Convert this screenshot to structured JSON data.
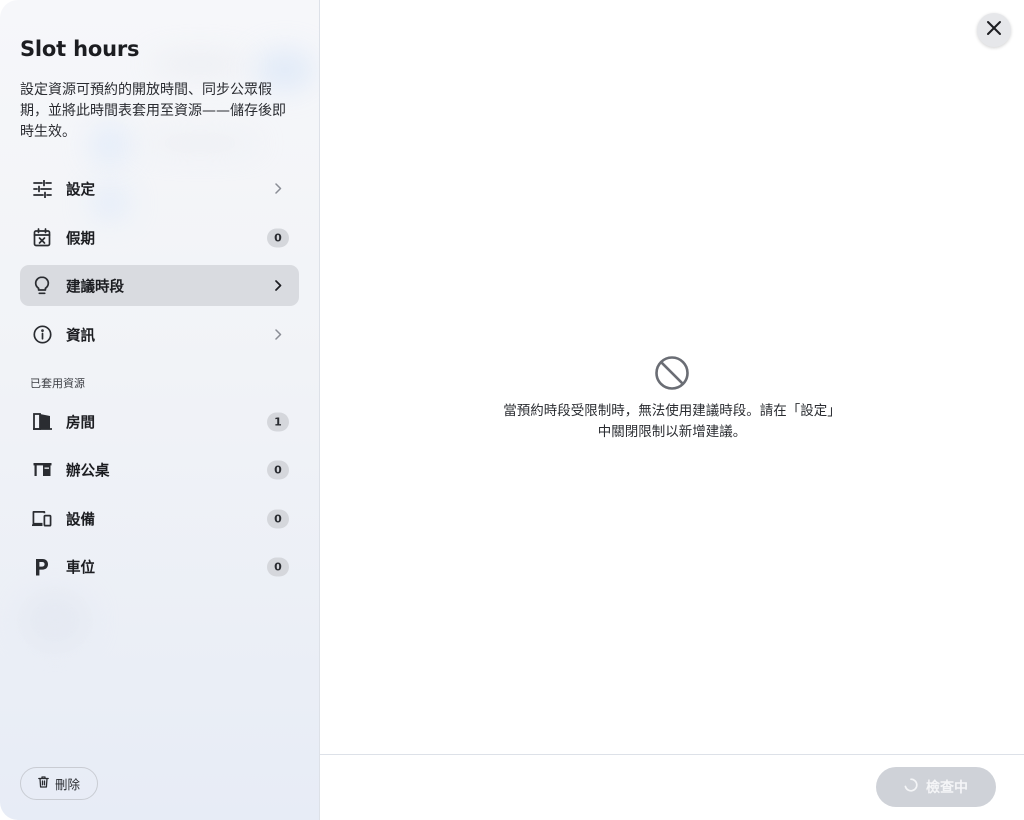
{
  "panel": {
    "title": "Slot hours",
    "description": "設定資源可預約的開放時間、同步公眾假期，並將此時間表套用至資源——儲存後即時生效。"
  },
  "nav": [
    {
      "id": "settings",
      "label": "設定",
      "icon": "sliders-icon",
      "has_chevron": true
    },
    {
      "id": "holidays",
      "label": "假期",
      "icon": "calendar-x-icon",
      "badge": "0"
    },
    {
      "id": "suggested",
      "label": "建議時段",
      "icon": "lightbulb-icon",
      "has_chevron": true,
      "active": true
    },
    {
      "id": "info",
      "label": "資訊",
      "icon": "info-icon",
      "has_chevron": true
    }
  ],
  "applied_resources": {
    "label": "已套用資源",
    "items": [
      {
        "id": "rooms",
        "label": "房間",
        "icon": "door-icon",
        "badge": "1"
      },
      {
        "id": "desks",
        "label": "辦公桌",
        "icon": "desk-icon",
        "badge": "0"
      },
      {
        "id": "equipment",
        "label": "設備",
        "icon": "devices-icon",
        "badge": "0"
      },
      {
        "id": "parking",
        "label": "車位",
        "icon": "parking-icon",
        "badge": "0"
      }
    ]
  },
  "actions": {
    "delete_label": "刪除",
    "checking_label": "檢查中"
  },
  "empty_state": {
    "icon": "block-icon",
    "line1": "當預約時段受限制時，無法使用建議時段。請在「設定」",
    "line2": "中關閉限制以新增建議。"
  },
  "colors": {
    "active_bg": "#d9dbe0",
    "badge_bg": "#d5d7dc",
    "disabled_btn": "#cfd2d8",
    "text": "#1c1d21"
  }
}
